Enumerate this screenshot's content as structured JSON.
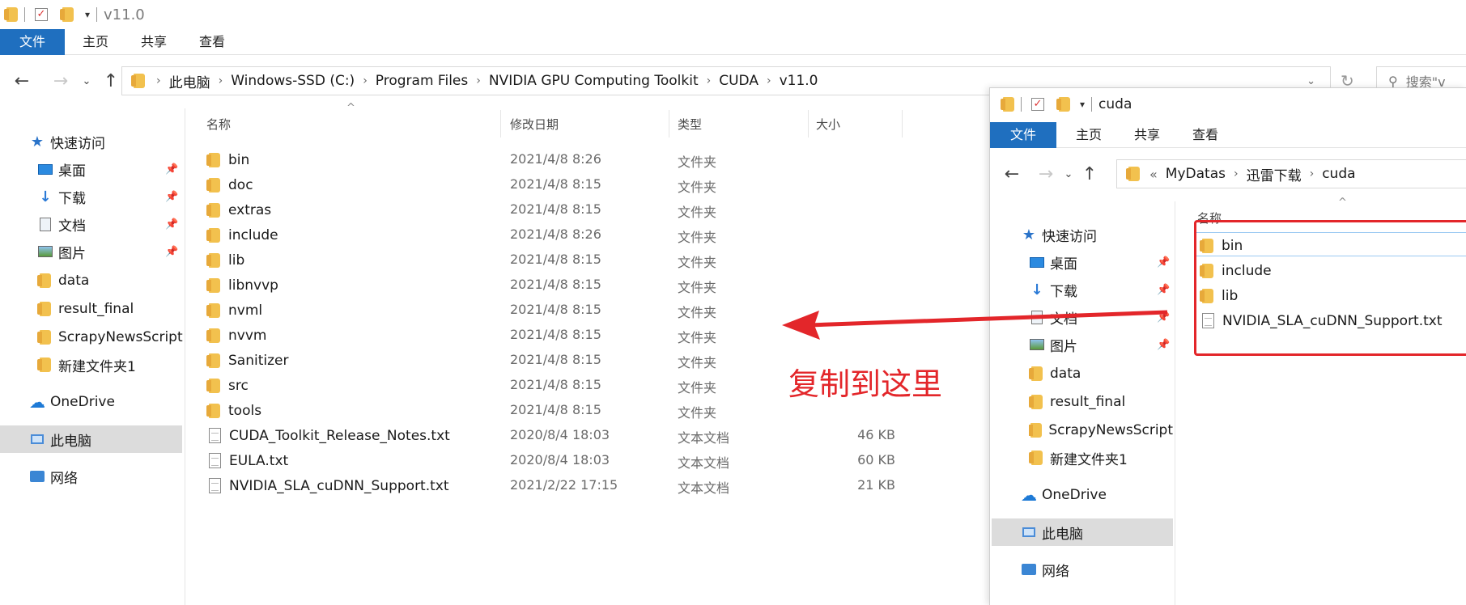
{
  "left_window": {
    "title": "v11.0",
    "tabs": [
      "文件",
      "主页",
      "共享",
      "查看"
    ],
    "breadcrumb": [
      "此电脑",
      "Windows-SSD (C:)",
      "Program Files",
      "NVIDIA GPU Computing Toolkit",
      "CUDA",
      "v11.0"
    ],
    "search_placeholder": "搜索\"v",
    "columns": {
      "name": "名称",
      "date": "修改日期",
      "type": "类型",
      "size": "大小"
    },
    "nav": {
      "quick_access": "快速访问",
      "items": [
        "桌面",
        "下载",
        "文档",
        "图片",
        "data",
        "result_final",
        "ScrapyNewsScript",
        "新建文件夹1"
      ],
      "onedrive": "OneDrive",
      "this_pc": "此电脑",
      "network": "网络"
    },
    "files": [
      {
        "name": "bin",
        "date": "2021/4/8 8:26",
        "type": "文件夹",
        "size": ""
      },
      {
        "name": "doc",
        "date": "2021/4/8 8:15",
        "type": "文件夹",
        "size": ""
      },
      {
        "name": "extras",
        "date": "2021/4/8 8:15",
        "type": "文件夹",
        "size": ""
      },
      {
        "name": "include",
        "date": "2021/4/8 8:26",
        "type": "文件夹",
        "size": ""
      },
      {
        "name": "lib",
        "date": "2021/4/8 8:15",
        "type": "文件夹",
        "size": ""
      },
      {
        "name": "libnvvp",
        "date": "2021/4/8 8:15",
        "type": "文件夹",
        "size": ""
      },
      {
        "name": "nvml",
        "date": "2021/4/8 8:15",
        "type": "文件夹",
        "size": ""
      },
      {
        "name": "nvvm",
        "date": "2021/4/8 8:15",
        "type": "文件夹",
        "size": ""
      },
      {
        "name": "Sanitizer",
        "date": "2021/4/8 8:15",
        "type": "文件夹",
        "size": ""
      },
      {
        "name": "src",
        "date": "2021/4/8 8:15",
        "type": "文件夹",
        "size": ""
      },
      {
        "name": "tools",
        "date": "2021/4/8 8:15",
        "type": "文件夹",
        "size": ""
      },
      {
        "name": "CUDA_Toolkit_Release_Notes.txt",
        "date": "2020/8/4 18:03",
        "type": "文本文档",
        "size": "46 KB"
      },
      {
        "name": "EULA.txt",
        "date": "2020/8/4 18:03",
        "type": "文本文档",
        "size": "60 KB"
      },
      {
        "name": "NVIDIA_SLA_cuDNN_Support.txt",
        "date": "2021/2/22 17:15",
        "type": "文本文档",
        "size": "21 KB"
      }
    ]
  },
  "right_window": {
    "title": "cuda",
    "tabs": [
      "文件",
      "主页",
      "共享",
      "查看"
    ],
    "breadcrumb_prefix": "«",
    "breadcrumb": [
      "MyDatas",
      "迅雷下载",
      "cuda"
    ],
    "columns": {
      "name": "名称"
    },
    "nav": {
      "quick_access": "快速访问",
      "items": [
        "桌面",
        "下载",
        "文档",
        "图片",
        "data",
        "result_final",
        "ScrapyNewsScript",
        "新建文件夹1"
      ],
      "onedrive": "OneDrive",
      "this_pc": "此电脑",
      "network": "网络"
    },
    "files": [
      {
        "name": "bin",
        "kind": "folder"
      },
      {
        "name": "include",
        "kind": "folder"
      },
      {
        "name": "lib",
        "kind": "folder"
      },
      {
        "name": "NVIDIA_SLA_cuDNN_Support.txt",
        "kind": "text"
      }
    ]
  },
  "annotation": {
    "text": "复制到这里",
    "color": "#e3262a"
  }
}
